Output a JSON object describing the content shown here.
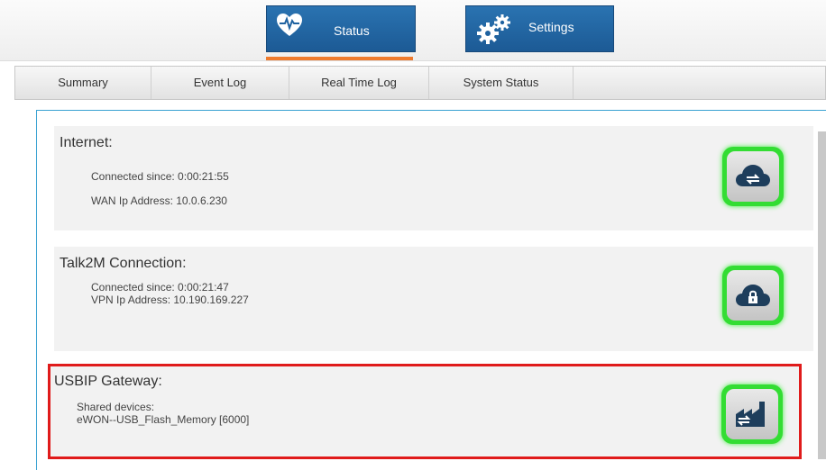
{
  "main_tabs": [
    {
      "label": "Status",
      "icon": "heart-pulse-icon",
      "active": true
    },
    {
      "label": "Settings",
      "icon": "gears-icon",
      "active": false
    }
  ],
  "colors": {
    "tab_blue": "#1f62a0",
    "active_underline": "#ee7b2e",
    "frame_border": "#3aa2d2",
    "highlight_border": "#e01b1b",
    "ok_glow": "#33dd33"
  },
  "subnav": {
    "items": [
      "Summary",
      "Event Log",
      "Real Time Log",
      "System Status"
    ]
  },
  "panels": [
    {
      "title": "Internet:",
      "lines": [
        "Connected since: 0:00:21:55",
        "WAN Ip Address: 10.0.6.230"
      ],
      "icon": "cloud-transfer-icon",
      "state": "ok"
    },
    {
      "title": "Talk2M Connection:",
      "lines": [
        "Connected since: 0:00:21:47",
        "VPN Ip Address: 10.190.169.227"
      ],
      "icon": "cloud-lock-icon",
      "state": "ok"
    },
    {
      "title": "USBIP Gateway:",
      "lines": [
        "Shared devices:",
        "eWON--USB_Flash_Memory [6000]"
      ],
      "icon": "factory-transfer-icon",
      "state": "ok",
      "highlighted": true
    }
  ]
}
